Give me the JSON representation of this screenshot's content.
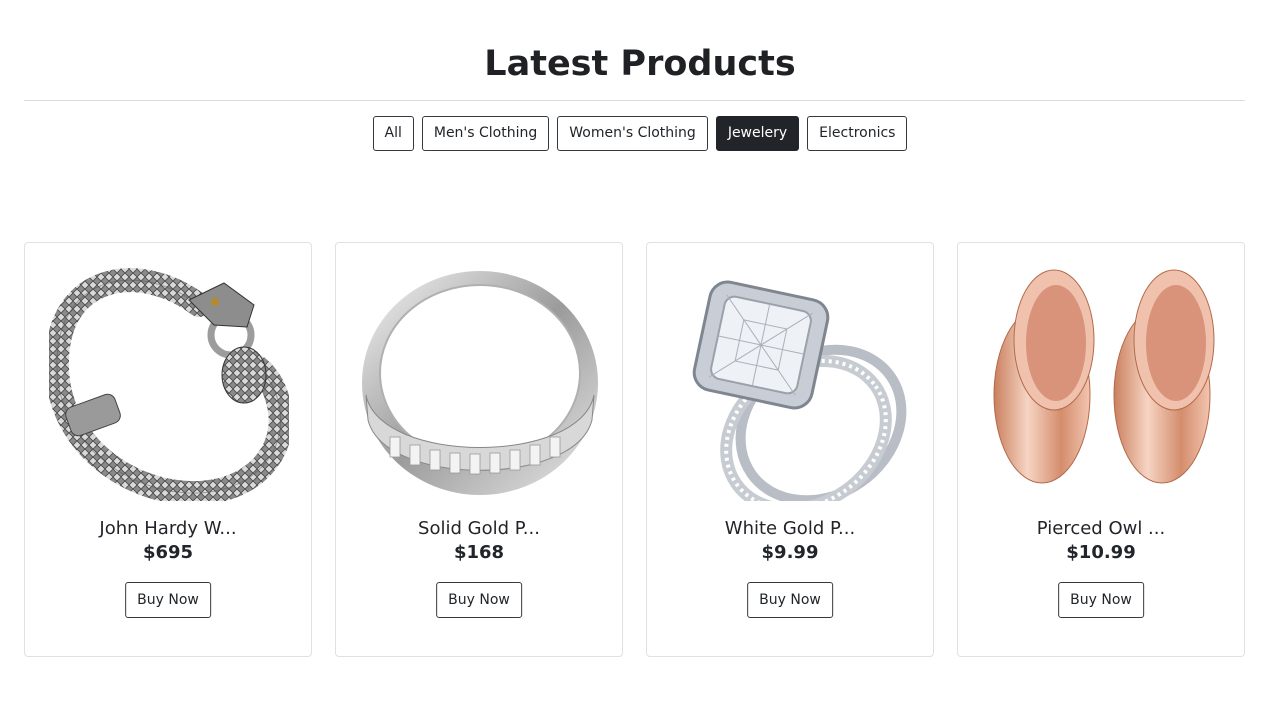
{
  "header": {
    "title": "Latest Products"
  },
  "filters": {
    "all": "All",
    "mens": "Men's Clothing",
    "womens": "Women's Clothing",
    "jewelery": "Jewelery",
    "electronics": "Electronics",
    "active": "Jewelery"
  },
  "products": [
    {
      "title": "John Hardy W...",
      "price": "$695",
      "buy_label": "Buy Now",
      "image": "silver-dragon-bracelet"
    },
    {
      "title": "Solid Gold P...",
      "price": "$168",
      "buy_label": "Buy Now",
      "image": "silver-band-ring"
    },
    {
      "title": "White Gold P...",
      "price": "$9.99",
      "buy_label": "Buy Now",
      "image": "diamond-engagement-ring-set"
    },
    {
      "title": "Pierced Owl ...",
      "price": "$10.99",
      "buy_label": "Buy Now",
      "image": "rose-gold-ear-plugs"
    }
  ],
  "colors": {
    "accent": "#212529",
    "border": "#dee2e6"
  }
}
